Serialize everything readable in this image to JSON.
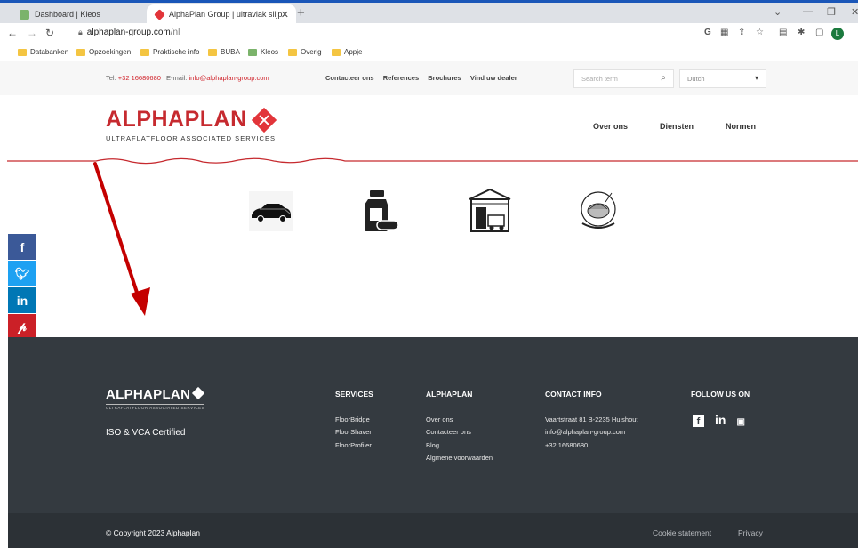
{
  "browser": {
    "tabs": [
      {
        "title": "Dashboard | Kleos",
        "active": false
      },
      {
        "title": "AlphaPlan Group | ultravlak slijp",
        "active": true
      }
    ],
    "url_host": "alphaplan-group.com",
    "url_path": "/nl",
    "profile_initial": "L",
    "bookmarks": [
      "Databanken",
      "Opzoekingen",
      "Praktische info",
      "BUBA",
      "Kleos",
      "Overig",
      "Appje"
    ]
  },
  "topbar": {
    "tel_label": "Tel:",
    "tel": "+32 16680680",
    "email_label": "E-mail:",
    "email": "info@alphaplan-group.com",
    "links": [
      "Contacteer ons",
      "References",
      "Brochures",
      "Vind uw dealer"
    ],
    "search_placeholder": "Search term",
    "language": "Dutch"
  },
  "header": {
    "logo_alpha": "ALPHA",
    "logo_plan": "PLAN",
    "logo_sub": "ULTRAFLATFLOOR ASSOCIATED SERVICES",
    "nav": [
      "Over ons",
      "Diensten",
      "Normen"
    ]
  },
  "sectors": [
    "car-icon",
    "chemical-bottle-icon",
    "warehouse-forklift-icon",
    "food-plate-icon"
  ],
  "social": [
    {
      "name": "facebook",
      "glyph": "f",
      "color": "#3b5998"
    },
    {
      "name": "twitter",
      "glyph": "t",
      "color": "#1da1f2"
    },
    {
      "name": "linkedin",
      "glyph": "in",
      "color": "#0077b5"
    },
    {
      "name": "pinterest",
      "glyph": "p",
      "color": "#cb2027"
    },
    {
      "name": "email",
      "glyph": "✉",
      "color": "#7d7d7d"
    }
  ],
  "footer": {
    "logo": "ALPHAPLAN",
    "logo_sub": "ULTRAFLATFLOOR ASSOCIATED SERVICES",
    "cert": "ISO & VCA Certified",
    "services": {
      "title": "SERVICES",
      "items": [
        "FloorBridge",
        "FloorShaver",
        "FloorProfiler"
      ]
    },
    "alphaplan": {
      "title": "ALPHAPLAN",
      "items": [
        "Over ons",
        "Contacteer ons",
        "Blog",
        "Algmene voorwaarden"
      ]
    },
    "contact": {
      "title": "CONTACT INFO",
      "items": [
        "Vaartstraat 81 B-2235 Hulshout",
        "info@alphaplan-group.com",
        "+32 16680680"
      ]
    },
    "follow": {
      "title": "FOLLOW US ON"
    },
    "copyright": "© Copyright 2023 Alphaplan",
    "bottom_links": [
      "Cookie statement",
      "Privacy"
    ]
  },
  "colors": {
    "brand_red": "#c62a2f",
    "footer_bg": "#343a40",
    "bottom_bg": "#2c3136",
    "annotation_arrow": "#c40000"
  }
}
